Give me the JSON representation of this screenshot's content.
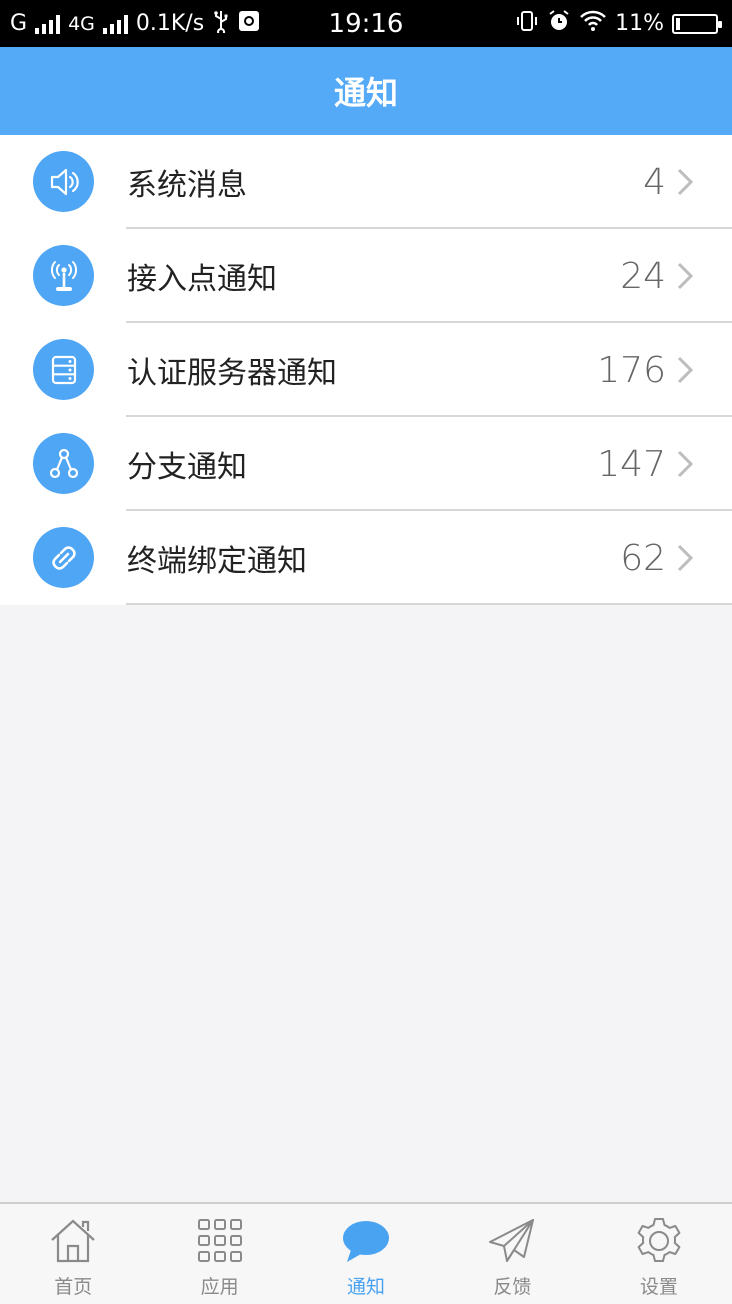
{
  "status_bar": {
    "carrier1": "G",
    "carrier2": "4G",
    "speed": "0.1K/s",
    "time": "19:16",
    "battery": "11%",
    "battery_level": 0.11
  },
  "header": {
    "title": "通知"
  },
  "notifications": [
    {
      "label": "系统消息",
      "count": "4",
      "icon": "speaker-icon"
    },
    {
      "label": "接入点通知",
      "count": "24",
      "icon": "antenna-icon"
    },
    {
      "label": "认证服务器通知",
      "count": "176",
      "icon": "server-icon"
    },
    {
      "label": "分支通知",
      "count": "147",
      "icon": "branch-icon"
    },
    {
      "label": "终端绑定通知",
      "count": "62",
      "icon": "link-icon"
    }
  ],
  "tabs": [
    {
      "label": "首页",
      "icon": "home-icon",
      "active": false
    },
    {
      "label": "应用",
      "icon": "apps-grid-icon",
      "active": false
    },
    {
      "label": "通知",
      "icon": "chat-bubble-icon",
      "active": true
    },
    {
      "label": "反馈",
      "icon": "paper-plane-icon",
      "active": false
    },
    {
      "label": "设置",
      "icon": "gear-icon",
      "active": false
    }
  ],
  "colors": {
    "header_bg": "#55aaf7",
    "icon_bg": "#4ea6f4",
    "tab_active": "#4aa3f1",
    "tab_inactive": "#8a8a8a",
    "page_bg": "#f4f3f6"
  }
}
